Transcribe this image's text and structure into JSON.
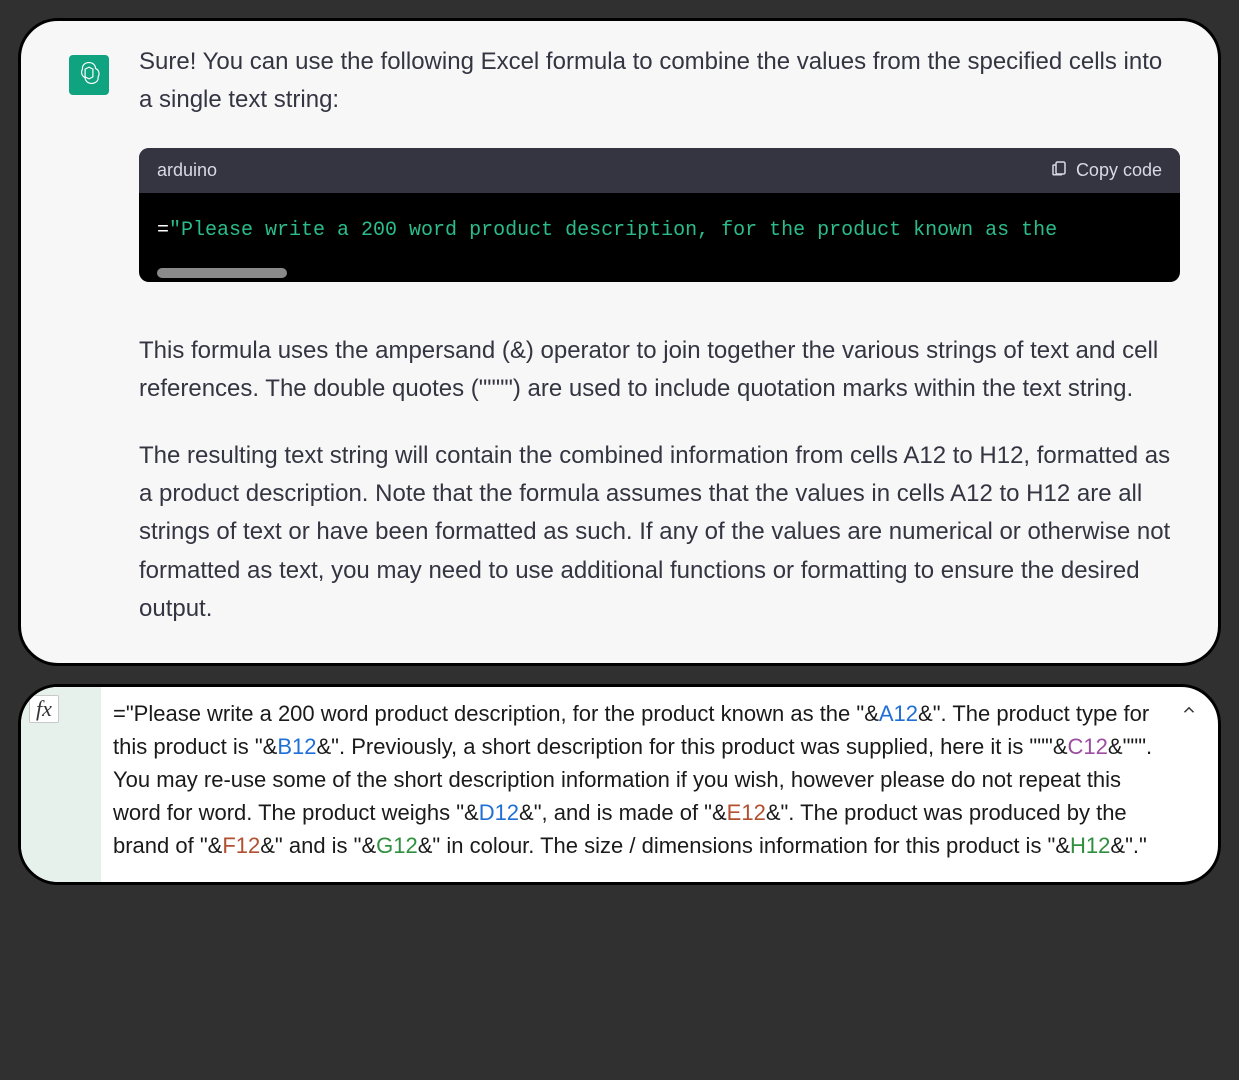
{
  "chat": {
    "intro": "Sure! You can use the following Excel formula to combine the values from the specified cells into a single text string:",
    "code": {
      "lang_label": "arduino",
      "copy_label": "Copy code",
      "visible_line_prefix": "=",
      "visible_line_string": "\"Please write a 200 word product description, for the product known as the"
    },
    "para1": "This formula uses the ampersand (&) operator to join together the various strings of text and cell references. The double quotes (\"\"\"\") are used to include quotation marks within the text string.",
    "para2": "The resulting text string will contain the combined information from cells A12 to H12, formatted as a product description. Note that the formula assumes that the values in cells A12 to H12 are all strings of text or have been formatted as such. If any of the values are numerical or otherwise not formatted as text, you may need to use additional functions or formatting to ensure the desired output."
  },
  "excel": {
    "fx_label": "fx",
    "formula_segments": [
      {
        "t": "text",
        "v": "=\"Please write a 200 word product description, for the product known as the \"&"
      },
      {
        "t": "ref",
        "v": "A12",
        "class": "ref-A"
      },
      {
        "t": "text",
        "v": "&\". The product type for this product is \"&"
      },
      {
        "t": "ref",
        "v": "B12",
        "class": "ref-B"
      },
      {
        "t": "text",
        "v": "&\". Previously, a short description for this product was supplied, here it is \"\"\"&"
      },
      {
        "t": "ref",
        "v": "C12",
        "class": "ref-C"
      },
      {
        "t": "text",
        "v": "&\"\"\". You may re-use some of the short description information if you wish, however please do not repeat this word for word. The product weighs \"&"
      },
      {
        "t": "ref",
        "v": "D12",
        "class": "ref-D"
      },
      {
        "t": "text",
        "v": "&\", and is made of \"&"
      },
      {
        "t": "ref",
        "v": "E12",
        "class": "ref-E"
      },
      {
        "t": "text",
        "v": "&\". The product was produced by the brand of \"&"
      },
      {
        "t": "ref",
        "v": "F12",
        "class": "ref-F"
      },
      {
        "t": "text",
        "v": "&\" and is \"&"
      },
      {
        "t": "ref",
        "v": "G12",
        "class": "ref-G"
      },
      {
        "t": "text",
        "v": "&\" in colour. The size / dimensions information for this product is \"&"
      },
      {
        "t": "ref",
        "v": "H12",
        "class": "ref-H"
      },
      {
        "t": "text",
        "v": "&\".\""
      }
    ]
  }
}
